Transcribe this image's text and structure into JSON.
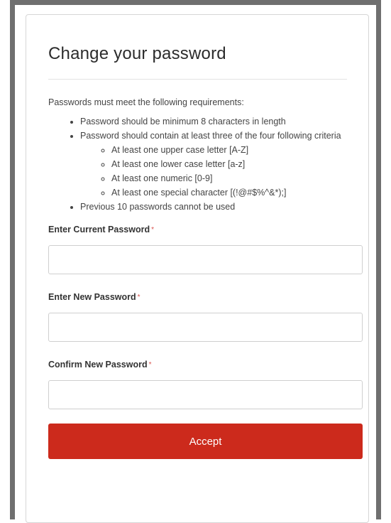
{
  "page": {
    "title": "Change your password"
  },
  "requirements": {
    "intro": "Passwords must meet the following requirements:",
    "min_length": "Password should be minimum 8 characters in length",
    "criteria_intro": "Password should contain at least three of the four following criteria",
    "criteria": [
      "At least one upper case letter [A-Z]",
      "At least one lower case letter [a-z]",
      "At least one numeric [0-9]",
      "At least one special character [(!@#$%^&*);]"
    ],
    "history": "Previous 10 passwords cannot be used"
  },
  "form": {
    "required_marker": "*",
    "current_password": {
      "label": "Enter Current Password",
      "value": ""
    },
    "new_password": {
      "label": "Enter New Password",
      "value": ""
    },
    "confirm_password": {
      "label": "Confirm New Password",
      "value": ""
    },
    "accept_label": "Accept"
  },
  "colors": {
    "accent": "#cc2a1c",
    "required": "#d9534f"
  }
}
